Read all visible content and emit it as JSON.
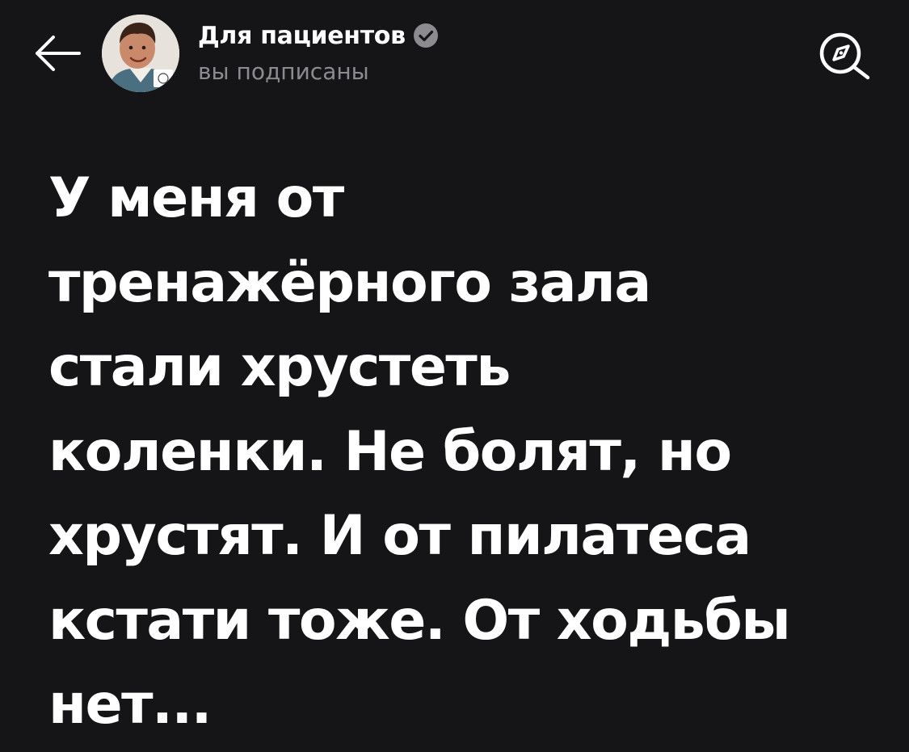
{
  "header": {
    "back_icon": "arrow-left-icon",
    "avatar_icon": "channel-avatar-photo",
    "channel_name": "Для пациентов",
    "verified_icon": "verified-check-icon",
    "subscription_status": "вы подписаны",
    "compass_icon": "compass-search-icon"
  },
  "post": {
    "lines": [
      "У меня от",
      "тренажёрного зала",
      "стали хрустеть",
      "коленки. Не болят, но",
      "хрустят. И от пилатеса",
      "кстати тоже. От ходьбы",
      "нет..."
    ]
  },
  "colors": {
    "background": "#151517",
    "text_primary": "#ffffff",
    "text_secondary": "#8b8b90",
    "verified_badge": "#8b8b90"
  }
}
